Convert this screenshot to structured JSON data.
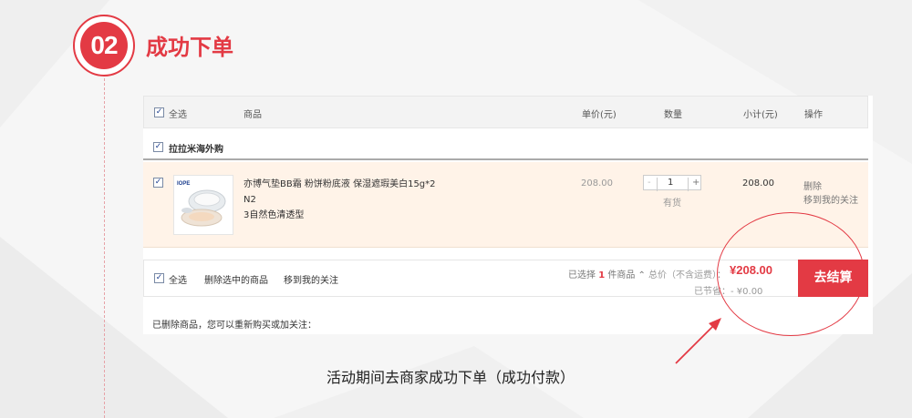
{
  "step": {
    "number": "02",
    "title": "成功下单"
  },
  "cart": {
    "header": {
      "select_all": "全选",
      "product": "商品",
      "unit_price": "单价(元)",
      "quantity": "数量",
      "subtotal": "小计(元)",
      "actions": "操作"
    },
    "shop": {
      "name": "拉拉米海外购"
    },
    "items": [
      {
        "brand": "IOPE",
        "name_line1": "亦博气垫BB霜 粉饼粉底液 保湿遮瑕美白15g*2 N2",
        "name_line2": "3自然色清透型",
        "unit_price": "208.00",
        "quantity": "1",
        "qty_minus": "-",
        "qty_plus": "+",
        "stock": "有货",
        "subtotal": "208.00",
        "action_delete": "删除",
        "action_favorite": "移到我的关注"
      }
    ],
    "footer": {
      "select_all": "全选",
      "delete_selected": "删除选中的商品",
      "move_to_favorites": "移到我的关注",
      "selected_prefix": "已选择",
      "selected_count": "1",
      "selected_suffix": "件商品",
      "total_label": "总价（不含运费）：",
      "total_value": "¥208.00",
      "saved_label": "已节省：",
      "saved_value": "- ¥0.00",
      "checkout": "去结算"
    },
    "deleted_note": "已删除商品，您可以重新购买或加关注："
  },
  "caption": "活动期间去商家成功下单（成功付款）",
  "colors": {
    "accent": "#e33a44",
    "item_bg": "#fff3e8"
  }
}
